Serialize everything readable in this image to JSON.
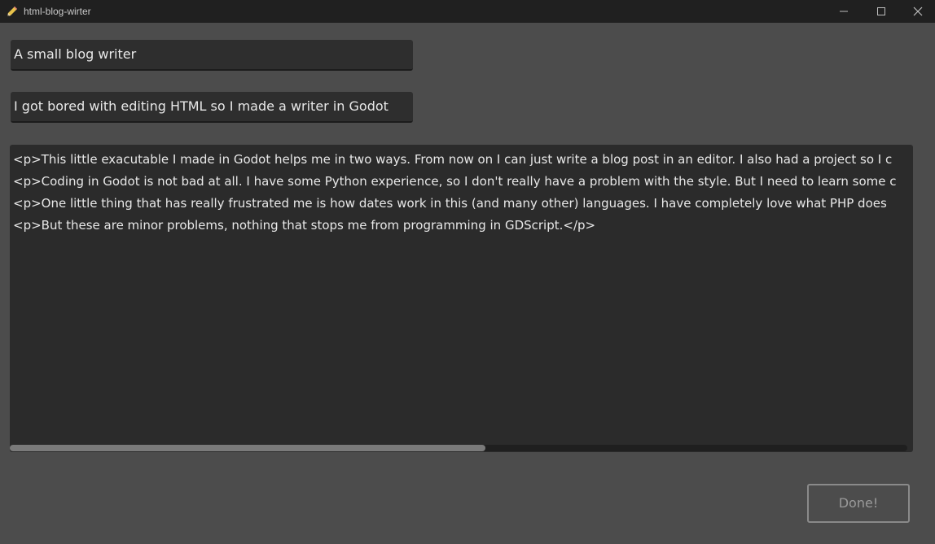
{
  "window": {
    "title": "html-blog-wirter",
    "icon": "pencil-icon"
  },
  "fields": {
    "title": "A small blog writer",
    "subtitle": "I got bored with editing HTML so I made a writer in Godot"
  },
  "editor": {
    "lines": [
      "<p>This little exacutable I made in Godot helps me in two ways. From now on I can just write a blog post in an editor. I also had a project so I c",
      "<p>Coding in Godot is not bad at all. I have some Python experience, so I don't really have a problem with the style. But I need to learn some c",
      "<p>One little thing that has really frustrated me is how dates work in this (and many other) languages. I have completely love what PHP does",
      "<p>But these are minor problems, nothing that stops me from programming in GDScript.</p>"
    ],
    "scroll_position_fraction": 0.53
  },
  "actions": {
    "done_label": "Done!"
  },
  "colors": {
    "background": "#4c4c4c",
    "titlebar": "#202020",
    "field": "#2e2e2e",
    "text": "#e8e8e8"
  }
}
